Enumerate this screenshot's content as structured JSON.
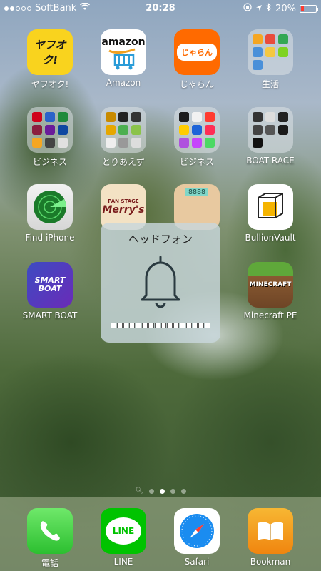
{
  "status": {
    "carrier": "SoftBank",
    "time": "20:28",
    "battery": "20%",
    "signal_bars": 2,
    "signal_total": 5,
    "battery_level": 0.2
  },
  "apps": [
    {
      "label": "ヤフオク!",
      "icon": "yahuoku-icon",
      "badge_text": "ヤフオク!"
    },
    {
      "label": "Amazon",
      "icon": "amazon-icon",
      "badge_text": "amazon"
    },
    {
      "label": "じゃらん",
      "icon": "jalan-icon",
      "badge_text": "じゃらん"
    },
    {
      "label": "生活",
      "icon": "folder-icon"
    },
    {
      "label": "ビジネス",
      "icon": "folder-icon"
    },
    {
      "label": "とりあえず",
      "icon": "folder-icon"
    },
    {
      "label": "ビジネス",
      "icon": "folder-icon"
    },
    {
      "label": "BOAT RACE",
      "icon": "folder-icon"
    },
    {
      "label": "Find iPhone",
      "icon": "find-iphone-icon"
    },
    {
      "label": "",
      "icon": "merrys-icon",
      "badge_text": "Merry's",
      "sub_text": "PAN STAGE"
    },
    {
      "label": "",
      "icon": "bear-timer-icon",
      "badge_text": "8888"
    },
    {
      "label": "BullionVault",
      "icon": "bullionvault-icon"
    },
    {
      "label": "SMART BOAT",
      "icon": "smart-boat-icon",
      "badge_text": "SMART BOAT"
    },
    {
      "label": "Minecraft PE",
      "icon": "minecraft-icon",
      "badge_text": "MINECRAFT"
    }
  ],
  "dock": [
    {
      "label": "電話",
      "icon": "phone-icon"
    },
    {
      "label": "LINE",
      "icon": "line-icon",
      "badge_text": "LINE"
    },
    {
      "label": "Safari",
      "icon": "safari-icon"
    },
    {
      "label": "Bookman",
      "icon": "bookman-icon"
    }
  ],
  "hud": {
    "title": "ヘッドフォン",
    "icon": "bell-icon",
    "level": 1.0,
    "segments": 16
  },
  "pages": {
    "count": 5,
    "active": 3
  }
}
